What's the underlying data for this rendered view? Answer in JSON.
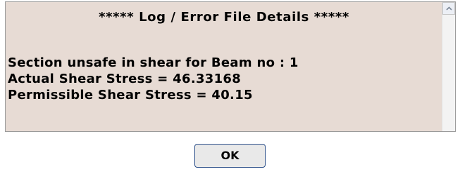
{
  "log": {
    "title": "***** Log / Error File Details *****",
    "lines": [
      "Section unsafe in shear for Beam no : 1",
      "Actual Shear Stress = 46.33168",
      "Permissible Shear Stress = 40.15"
    ]
  },
  "buttons": {
    "ok_label": "OK"
  },
  "icons": {
    "scroll_up": "chevron-up-icon"
  },
  "colors": {
    "log_background": "#e7dbd4",
    "button_border": "#2b4f8a"
  }
}
